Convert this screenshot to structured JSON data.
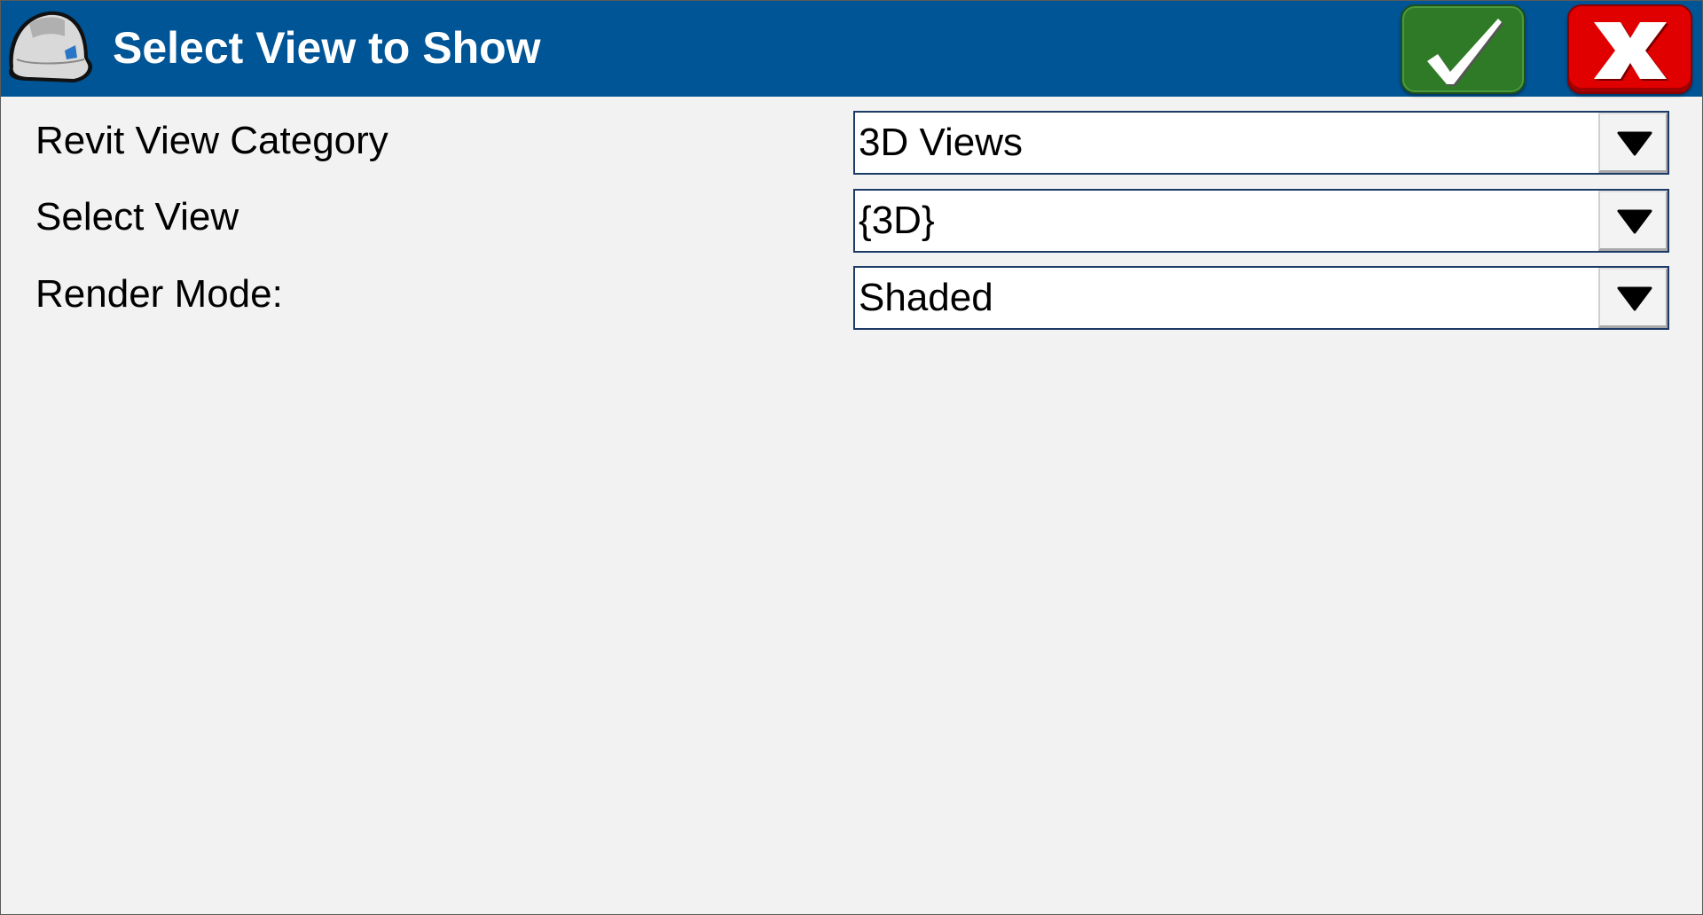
{
  "window": {
    "title": "Select View to Show",
    "logo_icon": "hard-hat-icon",
    "ok_button": {
      "icon": "checkmark-icon",
      "color": "#2f7a26"
    },
    "cancel_button": {
      "icon": "x-icon",
      "color": "#e00000"
    },
    "titlebar_color": "#005597"
  },
  "fields": [
    {
      "label": "Revit View Category",
      "value": "3D Views"
    },
    {
      "label": "Select View",
      "value": "{3D}"
    },
    {
      "label": "Render Mode:",
      "value": "Shaded"
    }
  ]
}
